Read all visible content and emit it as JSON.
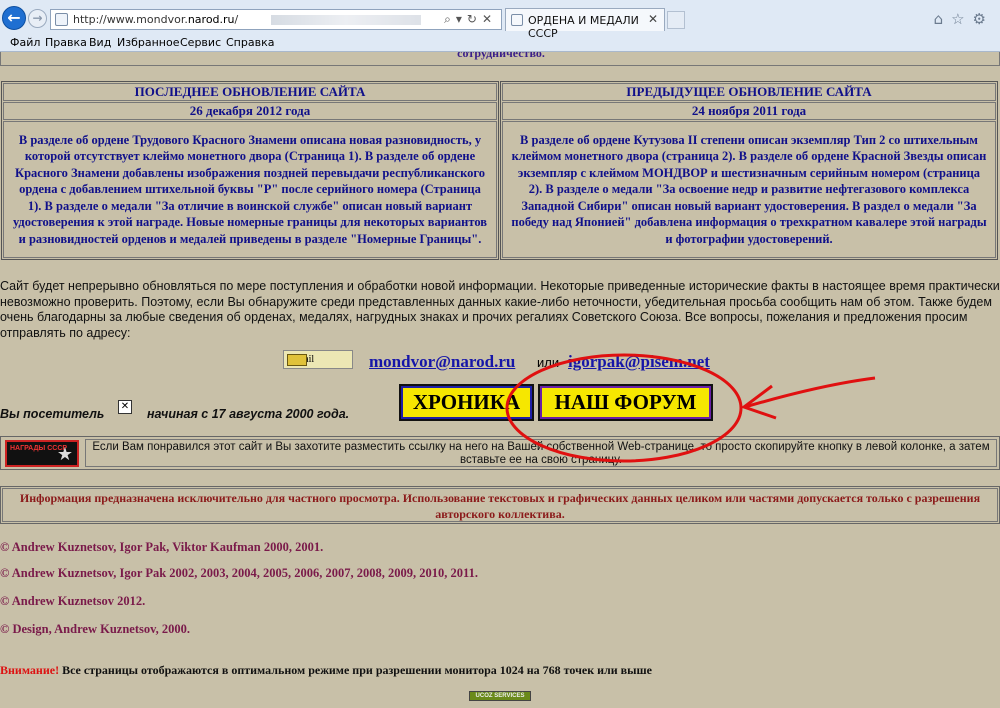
{
  "browser": {
    "url_host": "http://www.mondvor.",
    "url_bold": "narod.ru",
    "url_tail": "/",
    "tab_title": "ОРДЕНА И МЕДАЛИ СССР",
    "address_tools": "⌕▾↻✕",
    "right_icons": "⌂☆⚙",
    "menu": [
      "Файл",
      "Правка",
      "Вид",
      "Избранное",
      "Сервис",
      "Справка"
    ]
  },
  "page": {
    "top_cut_text": "сотрудничество.",
    "last_update": {
      "heading": "ПОСЛЕДНЕЕ ОБНОВЛЕНИЕ САЙТА",
      "date": "26 декабря 2012 года",
      "body": "В разделе об ордене Трудового Красного Знамени описана новая разновидность, у которой отсутствует клеймо монетного двора (Страница 1). В разделе об ордене Красного Знамени добавлены изображения поздней перевыдачи республиканского ордена с добавлением штихельной буквы \"Р\" после серийного номера (Страница 1). В разделе о медали \"За отличие в воинской службе\" описан новый вариант удостоверения к этой награде. Новые номерные границы для некоторых вариантов и разновидностей орденов и медалей приведены в разделе \"Номерные Границы\"."
    },
    "prev_update": {
      "heading": "ПРЕДЫДУЩЕЕ ОБНОВЛЕНИЕ САЙТА",
      "date": "24 ноября 2011 года",
      "body": "В разделе об ордене Кутузова II степени описан экземпляр Тип 2 со штихельным клеймом монетного двора (страница 2). В разделе об ордене Красной Звезды описан экземпляр с клеймом МОНДВОР и шестизначным серийным номером (страница 2). В разделе о медали \"За освоение недр и развитие нефтегазового комплекса Западной Сибири\" описан новый вариант удостоверения. В раздел о медали \"За победу над Японией\" добавлена информация о трехкратном кавалере этой награды и фотографии удостоверений."
    },
    "notice": "Сайт будет непрерывно обновляться по мере поступления и обработки новой информации. Некоторые приведенные исторические факты в настоящее время практически невозможно проверить. Поэтому, если Вы обнаружите среди представленных данных какие-либо неточности, убедительная просьба сообщить нам об этом. Также будем очень благодарны за любые сведения об орденах, медалях, нагрудных знаках и прочих  регалиях Советского Союза. Все вопросы, пожелания и предложения просим отправлять по адресу:",
    "email_label": "E-mail",
    "email1": "mondvor@narod.ru",
    "email_or": "или",
    "email2": "igorpak@pisem.net",
    "visitors_label": "Вы посетитель",
    "counter_glyph": "✕",
    "visitors_since": "начиная с 17 августа 2000 года.",
    "btn_chronicle": "ХРОНИКА",
    "btn_forum": "НАШ ФОРУМ",
    "link_button_text": "НАГРАДЫ СССР",
    "link_button_star": "★",
    "link_text": "Если Вам понравился этот сайт и Вы захотите разместить ссылку на него на Вашей собственной Web-странице, то просто скопируйте кнопку в левой колонке, а затем вставьте ее на свою страницу.",
    "info": "Информация предназначена исключительно для частного просмотра. Использование текстовых и графических данных целиком или частями допускается только с разрешения авторского коллектива.",
    "copyrights": [
      "© Andrew Kuznetsov, Igor Pak, Viktor Kaufman 2000, 2001.",
      "© Andrew Kuznetsov, Igor Pak 2002, 2003, 2004, 2005, 2006, 2007, 2008, 2009, 2010, 2011.",
      "© Andrew Kuznetsov 2012.",
      "© Design, Andrew Kuznetsov, 2000."
    ],
    "attention_label": "Внимание!",
    "attention_text": " Все страницы отображаются в оптимальном режиме при разрешении монитора 1024 на 768 точек или выше",
    "ucoz": "UCOZ SERVICES"
  },
  "colors": {
    "page_bg": "#c8c0a8",
    "heading_blue": "#10108a",
    "button_yellow": "#f6e700",
    "annotation_red": "#e01010"
  }
}
